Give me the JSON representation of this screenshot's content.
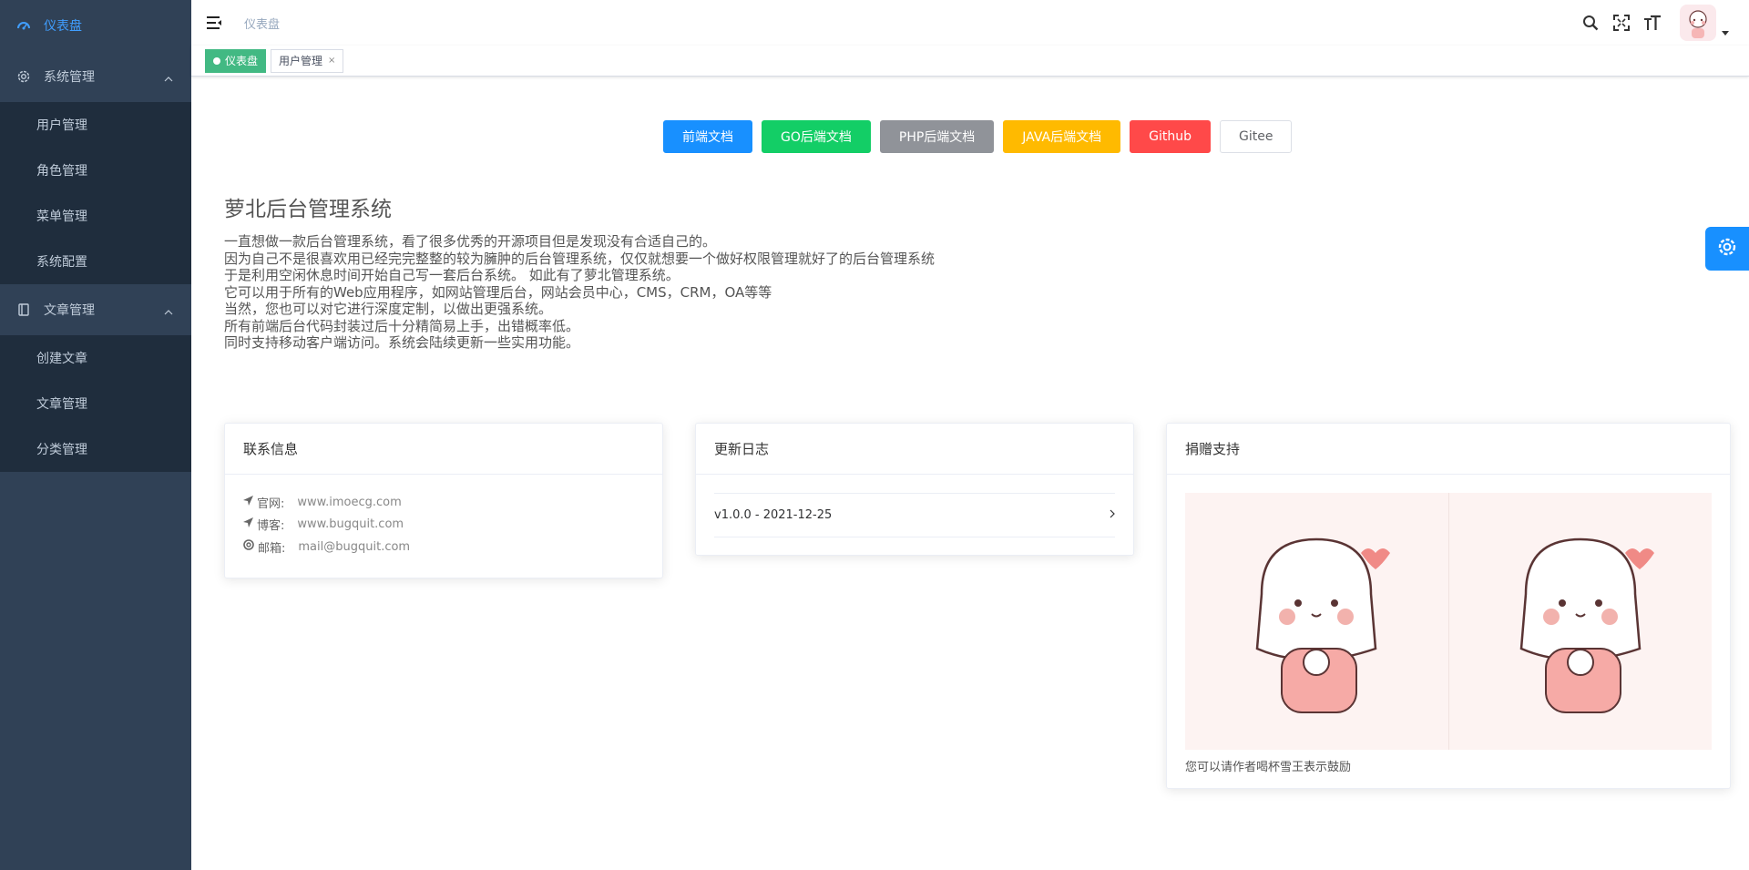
{
  "sidebar": {
    "dashboard": {
      "label": "仪表盘"
    },
    "groups": [
      {
        "label": "系统管理",
        "items": [
          {
            "label": "用户管理"
          },
          {
            "label": "角色管理"
          },
          {
            "label": "菜单管理"
          },
          {
            "label": "系统配置"
          }
        ]
      },
      {
        "label": "文章管理",
        "items": [
          {
            "label": "创建文章"
          },
          {
            "label": "文章管理"
          },
          {
            "label": "分类管理"
          }
        ]
      }
    ]
  },
  "header": {
    "breadcrumb": "仪表盘",
    "tools": [
      "search-icon",
      "fullscreen-icon",
      "font-size-icon"
    ]
  },
  "tags": [
    {
      "label": "仪表盘",
      "active": true
    },
    {
      "label": "用户管理",
      "active": false,
      "close": "×"
    }
  ],
  "buttons": [
    {
      "label": "前端文档",
      "color": "#1890ff"
    },
    {
      "label": "GO后端文档",
      "color": "#13ce66"
    },
    {
      "label": "PHP后端文档",
      "color": "#909399"
    },
    {
      "label": "JAVA后端文档",
      "color": "#ffba00"
    },
    {
      "label": "Github",
      "color": "#ff4949"
    },
    {
      "label": "Gitee",
      "color": "#ffffff"
    }
  ],
  "intro": {
    "title": "萝北后台管理系统",
    "lines": [
      "一直想做一款后台管理系统，看了很多优秀的开源项目但是发现没有合适自己的。",
      "因为自己不是很喜欢用已经完完整整的较为臃肿的后台管理系统，仅仅就想要一个做好权限管理就好了的后台管理系统",
      "于是利用空闲休息时间开始自己写一套后台系统。 如此有了萝北管理系统。",
      "它可以用于所有的Web应用程序，如网站管理后台，网站会员中心，CMS，CRM，OA等等",
      "当然，您也可以对它进行深度定制，以做出更强系统。",
      "所有前端后台代码封装过后十分精简易上手，出错概率低。",
      "同时支持移动客户端访问。系统会陆续更新一些实用功能。"
    ]
  },
  "contact": {
    "title": "联系信息",
    "rows": [
      {
        "key": "官网:",
        "value": "www.imoecg.com",
        "icon": "send-icon"
      },
      {
        "key": "博客:",
        "value": "www.bugquit.com",
        "icon": "send-icon"
      },
      {
        "key": "邮箱:",
        "value": "mail@bugquit.com",
        "icon": "support-icon"
      }
    ]
  },
  "changelog": {
    "title": "更新日志",
    "entries": [
      {
        "label": "v1.0.0 - 2021-12-25"
      }
    ]
  },
  "donate": {
    "title": "捐赠支持",
    "note": "您可以请作者喝杯雪王表示鼓励"
  }
}
